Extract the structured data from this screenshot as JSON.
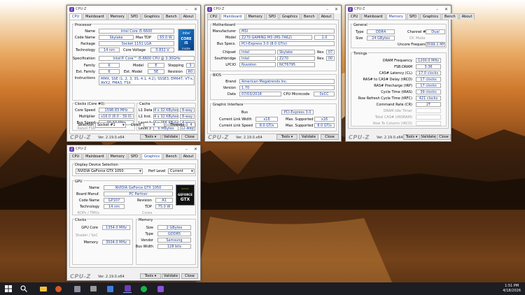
{
  "app": {
    "title": "CPU-Z",
    "brand": "CPU-Z",
    "version": "Ver. 2.19.0.x64",
    "tools": "Tools",
    "validate": "Validate",
    "close": "Close",
    "icon_text": "Z"
  },
  "tabs": [
    "CPU",
    "Mainboard",
    "Memory",
    "SPD",
    "Graphics",
    "Bench",
    "About"
  ],
  "cpu": {
    "g_processor": "Processor",
    "l_name": "Name",
    "name": "Intel Core i5 6600",
    "l_codename": "Code Name",
    "codename": "Skylake",
    "l_maxtdp": "Max TDP",
    "maxtdp": "65.0 W",
    "l_package": "Package",
    "package": "Socket 1151 LGA",
    "l_technology": "Technology",
    "technology": "14 nm",
    "l_corevoltage": "Core Voltage",
    "corevoltage": "0.832 V",
    "logo_line1": "intel",
    "logo_line2": "CORE i5",
    "logo_line3": "inside",
    "l_spec": "Specification",
    "spec": "Intel® Core™ i5-6600 CPU @ 3.30GHz",
    "l_family": "Family",
    "family": "6",
    "l_model": "Model",
    "model": "E",
    "l_stepping": "Stepping",
    "stepping": "3",
    "l_extfamily": "Ext. Family",
    "extfamily": "6",
    "l_extmodel": "Ext. Model",
    "extmodel": "5E",
    "l_revision": "Revision",
    "revision": "R0",
    "l_instructions": "Instructions",
    "instructions1": "MMX, SSE (1, 2, 3, 3S, 4.1, 4.2), SSSE3, EM64T, VT-x, AES, AVX,",
    "instructions2": "AVX2, FMA3, TSX",
    "g_clocks": "Clocks (Core #0)",
    "l_corespeed": "Core Speed",
    "corespeed": "1598.83 MHz",
    "l_multiplier": "Multiplier",
    "multiplier": "x16.0 (8.0 - 39.0)",
    "l_busspeed": "Bus Speed",
    "busspeed": "99.93 MHz",
    "l_ratedfsb": "Rated FSB",
    "g_cache": "Cache",
    "l_l1data": "L1 Data",
    "l1data": "4 x 32 KBytes",
    "l1data_way": "8-way",
    "l_l1inst": "L1 Inst.",
    "l1inst": "4 x 32 KBytes",
    "l1inst_way": "8-way",
    "l_level2": "Level 2",
    "level2": "4 x 256 KBytes",
    "level2_way": "4-way",
    "l_level3": "Level 3",
    "level3": "6 MBytes",
    "level3_way": "12-way",
    "l_selection": "Selection",
    "selection": "Socket #1",
    "l_cores": "Cores",
    "cores": "4",
    "l_threads": "Threads",
    "threads": "4"
  },
  "mainboard": {
    "g_motherboard": "Motherboard",
    "l_manufacturer": "Manufacturer",
    "manufacturer": "MSI",
    "l_model": "Model",
    "model": "Z270 GAMING M3 (MS-7A62)",
    "model_rev": "1.0",
    "l_busspecs": "Bus Specs.",
    "busspecs": "PCI-Express 3.0 (8.0 GT/s)",
    "l_chipset": "Chipset",
    "chipset_vendor": "Intel",
    "chipset": "Skylake",
    "l_rev": "Rev.",
    "chipset_rev": "07",
    "l_southbridge": "Southbridge",
    "south_vendor": "Intel",
    "south": "Z270",
    "south_rev": "00",
    "l_lpcio": "LPCIO",
    "lpcio_vendor": "Nuvoton",
    "lpcio": "NCT6795",
    "g_bios": "BIOS",
    "l_brand": "Brand",
    "brand": "American Megatrends Inc.",
    "l_version": "Version",
    "version": "1.70",
    "l_date": "Date",
    "date": "07/03/2018",
    "l_microcode": "CPU Microcode",
    "microcode": "0xCC",
    "g_graphic": "Graphic Interface",
    "l_bus": "Bus",
    "bus": "PCI-Express 3.0",
    "l_curwidth": "Current Link Width",
    "curwidth": "x16",
    "l_maxsup": "Max. Supported",
    "maxwidth": "x16",
    "l_curspeed": "Current Link Speed",
    "curspeed": "8.0 GT/s",
    "maxspeed": "8.0 GT/s"
  },
  "memory": {
    "g_general": "General",
    "l_type": "Type",
    "type": "DDR4",
    "l_channel": "Channel #",
    "channel": "Dual",
    "l_size": "Size",
    "size": "24 GBytes",
    "l_dcmode": "DC Mode",
    "l_uncore": "Uncore Frequency",
    "uncore": "3599.1 MHz",
    "g_timings": "Timings",
    "l_dramfreq": "DRAM Frequency",
    "dramfreq": "1200.0 MHz",
    "l_fsbdram": "FSB:DRAM",
    "fsbdram": "3:36",
    "l_cas": "CAS# Latency (CL)",
    "cas": "17.0 clocks",
    "l_rcd": "RAS# to CAS# Delay (tRCD)",
    "rcd": "17 clocks",
    "l_rp": "RAS# Precharge (tRP)",
    "rp": "17 clocks",
    "l_ras": "Cycle Time (tRAS)",
    "ras": "39 clocks",
    "l_rfc": "Row Refresh Cycle Time (tRFC)",
    "rfc": "421 clocks",
    "l_cr": "Command Rate (CR)",
    "cr": "2T",
    "l_idle": "DRAM Idle Timer",
    "l_trdram": "Total CAS# (tRDRAM)",
    "l_rtc": "Row To Column (tRCD)"
  },
  "graphics": {
    "g_display": "Display Device Selection",
    "device": "NVIDIA GeForce GTX 1050",
    "l_perflevel": "Perf Level",
    "perflevel": "Current",
    "g_gpu": "GPU",
    "l_name": "Name",
    "name": "NVIDIA GeForce GTX 1050",
    "l_boardmanuf": "Board Manuf.",
    "boardmanuf": "PC Partner",
    "l_codename": "Code Name",
    "codename": "GP107",
    "l_revision": "Revision",
    "revision": "A1",
    "l_technology": "Technology",
    "technology": "14 nm",
    "l_tdp": "TDP",
    "tdp": "75.0 W",
    "l_rops": "ROPs / TMUs",
    "l_cores": "Cores",
    "logo_line1": "NVIDIA",
    "logo_line2": "GEFORCE",
    "logo_line3": "GTX",
    "g_clocks": "Clocks",
    "l_gpucore": "GPU Core",
    "gpucore": "1354.0 MHz",
    "l_shader": "Shader / SoC",
    "l_memory": "Memory",
    "memclock": "3504.0 MHz",
    "g_memory": "Memory",
    "l_size": "Size",
    "size": "2 GBytes",
    "l_type": "Type",
    "type": "GDDR5",
    "l_vendor": "Vendor",
    "vendor": "Samsung",
    "l_buswidth": "Bus Width",
    "buswidth": "128 bits"
  },
  "taskbar": {
    "time": "1:51 PM",
    "date": "4/18/2026",
    "start_icon": "windows-start-icon",
    "search_icon": "search-icon"
  },
  "colors": {
    "value_text": "#1a3e9e",
    "accent": "#6a3fb0",
    "taskbar": "#1d1d24"
  }
}
